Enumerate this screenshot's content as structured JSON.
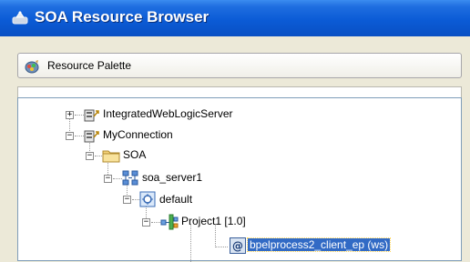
{
  "window": {
    "title": "SOA Resource Browser",
    "icon": "soa-browser-icon"
  },
  "palette": {
    "label": "Resource Palette",
    "icon": "resource-palette-icon"
  },
  "tree": {
    "nodes": [
      {
        "label": "IntegratedWebLogicServer",
        "icon": "server-connection-icon",
        "expander": "+"
      },
      {
        "label": "MyConnection",
        "icon": "server-connection-icon",
        "expander": "−"
      },
      {
        "label": "SOA",
        "icon": "folder-icon",
        "expander": "−"
      },
      {
        "label": "soa_server1",
        "icon": "soa-server-icon",
        "expander": "−"
      },
      {
        "label": "default",
        "icon": "partition-icon",
        "expander": "−"
      },
      {
        "label": "Project1 [1.0]",
        "icon": "composite-icon",
        "expander": "−"
      },
      {
        "label": "bpelprocess2_client_ep (ws)",
        "icon": "web-service-endpoint-icon",
        "selected": true
      }
    ]
  }
}
